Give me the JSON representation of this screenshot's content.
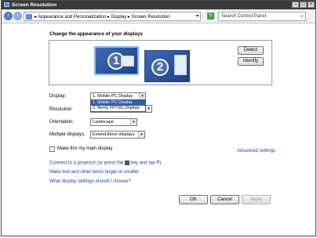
{
  "window": {
    "title": "Screen Resolution"
  },
  "nav": {
    "breadcrumb": "▸ Appearance and Personalization ▸ Display ▸ Screen Resolution",
    "search_placeholder": "Search Control Panel"
  },
  "heading": "Change the appearance of your displays",
  "preview": {
    "monitors": [
      "1",
      "2"
    ],
    "detect_label": "Detect",
    "identify_label": "Identify"
  },
  "settings": {
    "display_label": "Display:",
    "display_value": "1. Mobile PC Display",
    "display_options": [
      "1. Mobile PC Display",
      "2. BenQ FP73G (Digital)"
    ],
    "resolution_label": "Resolution:",
    "orientation_label": "Orientation:",
    "orientation_value": "Landscape",
    "multiple_label": "Multiple displays:",
    "multiple_value": "Extend these displays",
    "main_display_label": "Make this my main display",
    "advanced_label": "Advanced settings"
  },
  "links": {
    "projector_pre": "Connect to a projector (or press the",
    "projector_post": "key and tap P)",
    "text_size": "Make text and other items larger or smaller",
    "which_settings": "What display settings should I choose?"
  },
  "buttons": {
    "ok": "OK",
    "cancel": "Cancel",
    "apply": "Apply"
  }
}
